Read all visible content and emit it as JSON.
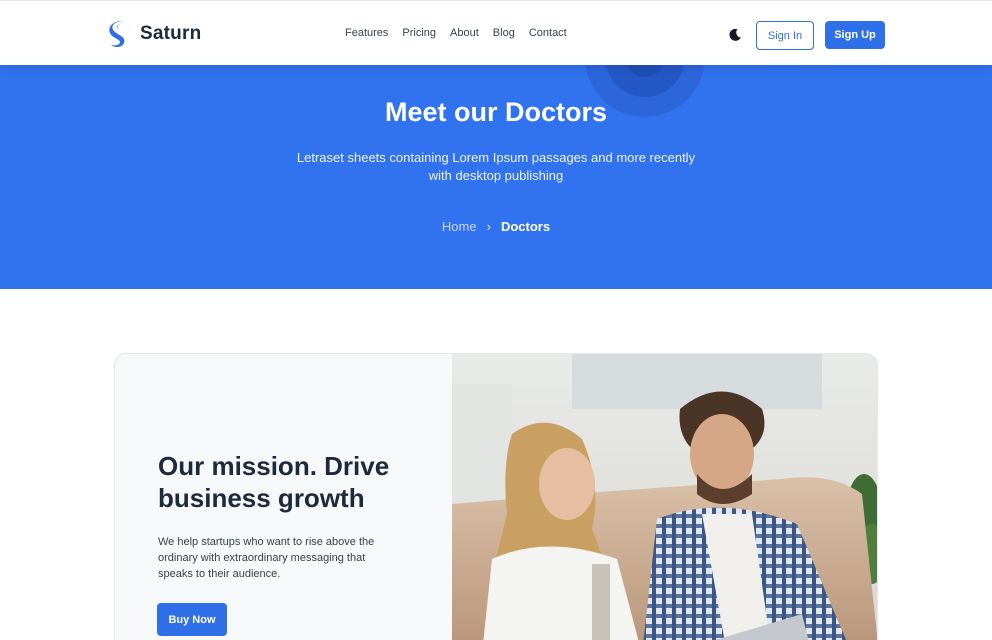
{
  "brand": {
    "name": "Saturn",
    "accent": "#2f6fe8"
  },
  "nav": {
    "items": [
      "Features",
      "Pricing",
      "About",
      "Blog",
      "Contact"
    ]
  },
  "header": {
    "theme_icon": "moon-icon",
    "signin_label": "Sign In",
    "signup_label": "Sign Up"
  },
  "hero": {
    "title": "Meet our Doctors",
    "subtitle": "Letraset sheets containing Lorem Ipsum passages and more recently with desktop publishing",
    "breadcrumb": {
      "home": "Home",
      "separator": "›",
      "current": "Doctors"
    },
    "background": "#3172ee"
  },
  "mission": {
    "title": "Our mission. Drive business growth",
    "text": "We help startups who want to rise above the ordinary with extraordinary messaging that speaks to their audience.",
    "button_label": "Buy Now"
  }
}
